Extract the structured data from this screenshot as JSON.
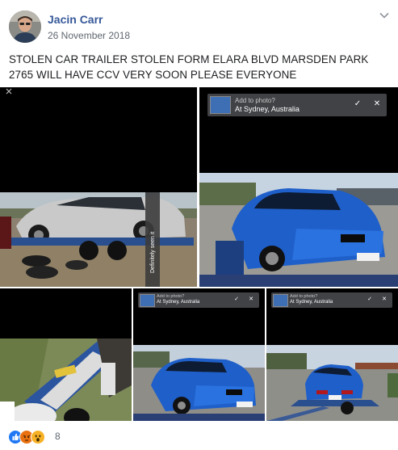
{
  "post": {
    "author": "Jacin Carr",
    "date": "26 November 2018",
    "text": "STOLEN CAR TRAILER STOLEN FORM ELARA BLVD MARSDEN PARK 2765 WILL HAVE CCV VERY SOON PLEASE EVERYONE",
    "options_icon": "chevron-down-icon"
  },
  "photos": {
    "snap_caption": "Definitely seen it",
    "overlay": {
      "title": "Add to photo?",
      "location": "At Sydney, Australia"
    }
  },
  "reactions": {
    "icons": [
      "like-icon",
      "angry-icon",
      "wow-icon"
    ],
    "count": "8",
    "colors": {
      "like": "#2078f4",
      "angry": "#e9710f",
      "wow": "#f7b125"
    }
  },
  "colors": {
    "author_link": "#365899",
    "meta_text": "#606770",
    "body_text": "#1c1e21"
  }
}
